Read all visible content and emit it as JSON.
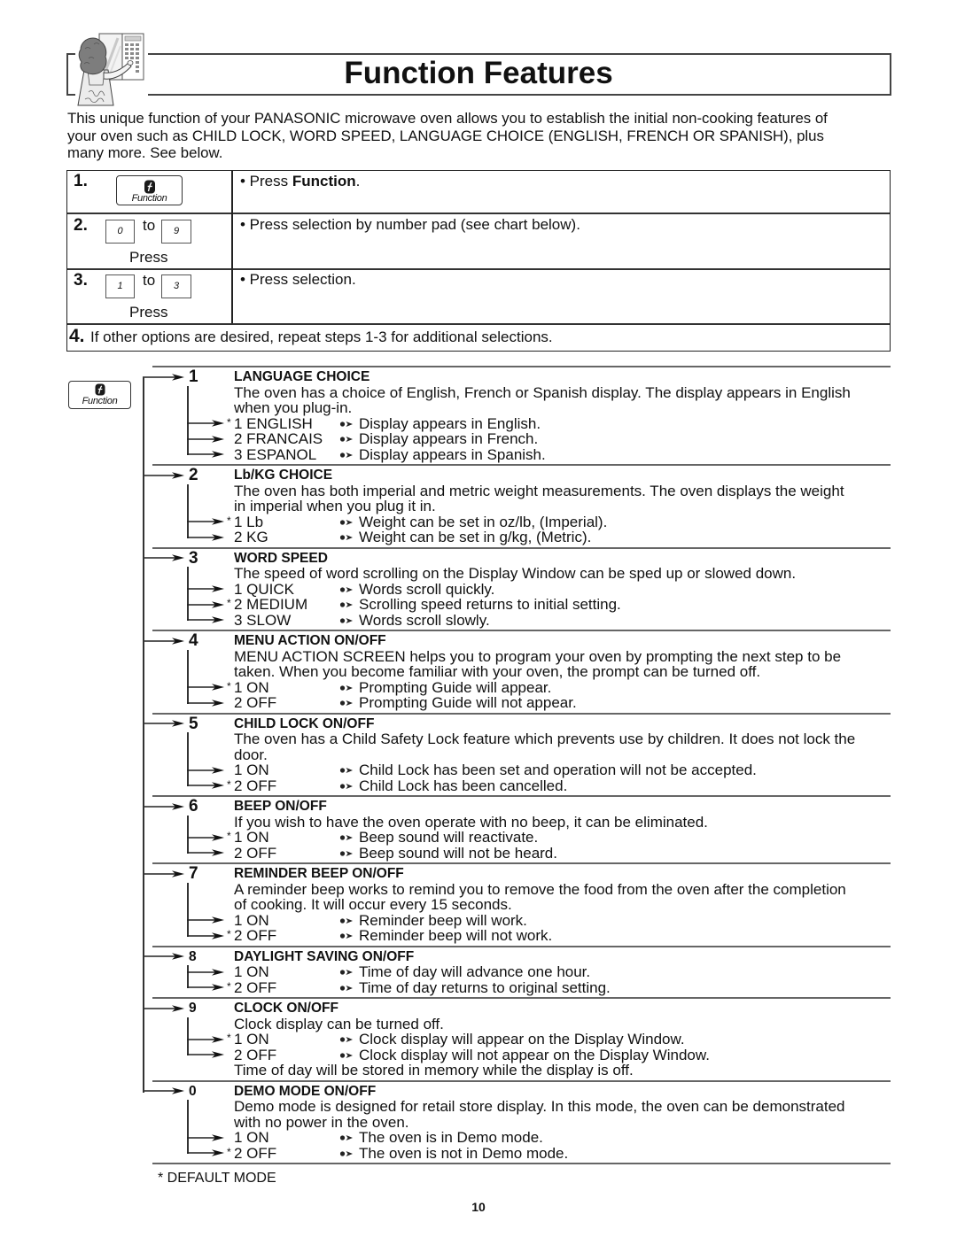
{
  "page": {
    "title": "Function Features",
    "page_number": "10"
  },
  "intro": {
    "lines": [
      "This unique function of your PANASONIC microwave oven allows you to establish the initial non-cooking features of",
      "your oven such as CHILD LOCK, WORD SPEED, LANGUAGE CHOICE (ENGLISH, FRENCH OR SPANISH), plus",
      "many more. See below."
    ]
  },
  "icons": {
    "function_key": "function-key-icon",
    "option_bullet": "arrow-bullet-icon",
    "branch_arrow": "arrow-right-icon",
    "illustration": "woman-at-microwave-illustration"
  },
  "steps": [
    {
      "number": "1.",
      "key_label": "Function",
      "instruction_prefix": "• Press ",
      "instruction_bold": "Function",
      "instruction_suffix": "."
    },
    {
      "number": "2.",
      "key_from": "0",
      "to": "to",
      "key_to": "9",
      "press": "Press",
      "instruction": "• Press selection by number pad (see chart below)."
    },
    {
      "number": "3.",
      "key_from": "1",
      "to": "to",
      "key_to": "3",
      "press": "Press",
      "instruction": "• Press selection."
    },
    {
      "number": "4.",
      "instruction": "If other options are desired, repeat steps 1-3 for additional selections."
    }
  ],
  "chart": {
    "function_key_label": "Function",
    "default_marker": "*",
    "sections": [
      {
        "number": "1",
        "title": "LANGUAGE CHOICE",
        "description_lines": [
          "The oven has a choice of English, French or Spanish display. The display appears in English",
          "when you plug-in."
        ],
        "options": [
          {
            "is_default": true,
            "label": "1 ENGLISH",
            "description": "Display appears in English."
          },
          {
            "is_default": false,
            "label": "2 FRANCAIS",
            "description": "Display appears in French."
          },
          {
            "is_default": false,
            "label": "3 ESPANOL",
            "description": "Display appears in Spanish."
          }
        ],
        "notes": []
      },
      {
        "number": "2",
        "title": "Lb/KG CHOICE",
        "description_lines": [
          "The oven has both imperial and metric weight measurements. The oven displays the weight",
          "in imperial when you plug it in."
        ],
        "options": [
          {
            "is_default": true,
            "label": "1 Lb",
            "description": "Weight can be set in oz/lb, (Imperial)."
          },
          {
            "is_default": false,
            "label": "2 KG",
            "description": "Weight can be set in g/kg, (Metric)."
          }
        ],
        "notes": []
      },
      {
        "number": "3",
        "title": "WORD SPEED",
        "description_lines": [
          "The speed of word scrolling on the Display Window can be sped up or slowed down."
        ],
        "options": [
          {
            "is_default": false,
            "label": "1 QUICK",
            "description": "Words scroll quickly."
          },
          {
            "is_default": true,
            "label": "2 MEDIUM",
            "description": "Scrolling speed returns to initial setting."
          },
          {
            "is_default": false,
            "label": "3 SLOW",
            "description": "Words scroll slowly."
          }
        ],
        "notes": []
      },
      {
        "number": "4",
        "title": "MENU ACTION ON/OFF",
        "description_lines": [
          "MENU ACTION SCREEN helps you to program your oven by prompting the next step to be",
          "taken. When you become familiar with your oven, the prompt can be turned off."
        ],
        "options": [
          {
            "is_default": true,
            "label": "1 ON",
            "description": "Prompting Guide will appear."
          },
          {
            "is_default": false,
            "label": "2 OFF",
            "description": "Prompting Guide will not appear."
          }
        ],
        "notes": []
      },
      {
        "number": "5",
        "title": "CHILD LOCK ON/OFF",
        "description_lines": [
          "The oven has a Child Safety Lock feature which prevents use by children. It does not lock the",
          "door."
        ],
        "options": [
          {
            "is_default": false,
            "label": "1 ON",
            "description": "Child Lock has been set and operation will not be accepted."
          },
          {
            "is_default": true,
            "label": "2 OFF",
            "description": "Child Lock has been cancelled."
          }
        ],
        "notes": []
      },
      {
        "number": "6",
        "title": "BEEP ON/OFF",
        "description_lines": [
          "If you wish to have the oven operate with no beep, it can be eliminated."
        ],
        "options": [
          {
            "is_default": true,
            "label": "1 ON",
            "description": "Beep sound will reactivate."
          },
          {
            "is_default": false,
            "label": "2 OFF",
            "description": "Beep sound will not be heard."
          }
        ],
        "notes": []
      },
      {
        "number": "7",
        "title": "REMINDER BEEP ON/OFF",
        "description_lines": [
          "A reminder beep works to remind you to remove the food from the oven after the completion",
          "of cooking. It will occur every 15 seconds."
        ],
        "options": [
          {
            "is_default": false,
            "label": "1 ON",
            "description": "Reminder beep will work."
          },
          {
            "is_default": true,
            "label": "2 OFF",
            "description": "Reminder beep will not work."
          }
        ],
        "notes": []
      },
      {
        "number": "8",
        "title": "DAYLIGHT SAVING ON/OFF",
        "description_lines": [],
        "options": [
          {
            "is_default": false,
            "label": "1 ON",
            "description": "Time of day will advance one hour."
          },
          {
            "is_default": true,
            "label": "2 OFF",
            "description": "Time of day returns to original setting."
          }
        ],
        "notes": []
      },
      {
        "number": "9",
        "title": "CLOCK ON/OFF",
        "description_lines": [
          "Clock display can be turned off."
        ],
        "options": [
          {
            "is_default": true,
            "label": "1 ON",
            "description": "Clock display will appear on the Display Window."
          },
          {
            "is_default": false,
            "label": "2 OFF",
            "description": "Clock display will not appear on the Display Window."
          }
        ],
        "notes": [
          "Time of day will be stored in memory while the display is off."
        ]
      },
      {
        "number": "0",
        "title": "DEMO MODE ON/OFF",
        "description_lines": [
          "Demo mode is designed for retail store display. In this mode, the oven can be demonstrated",
          "with no power in the oven."
        ],
        "options": [
          {
            "is_default": false,
            "label": "1 ON",
            "description": "The oven is in Demo mode."
          },
          {
            "is_default": true,
            "label": "2 OFF",
            "description": "The oven is not in Demo mode."
          }
        ],
        "notes": []
      }
    ]
  },
  "footer": {
    "default_mode_note": "* DEFAULT MODE"
  }
}
